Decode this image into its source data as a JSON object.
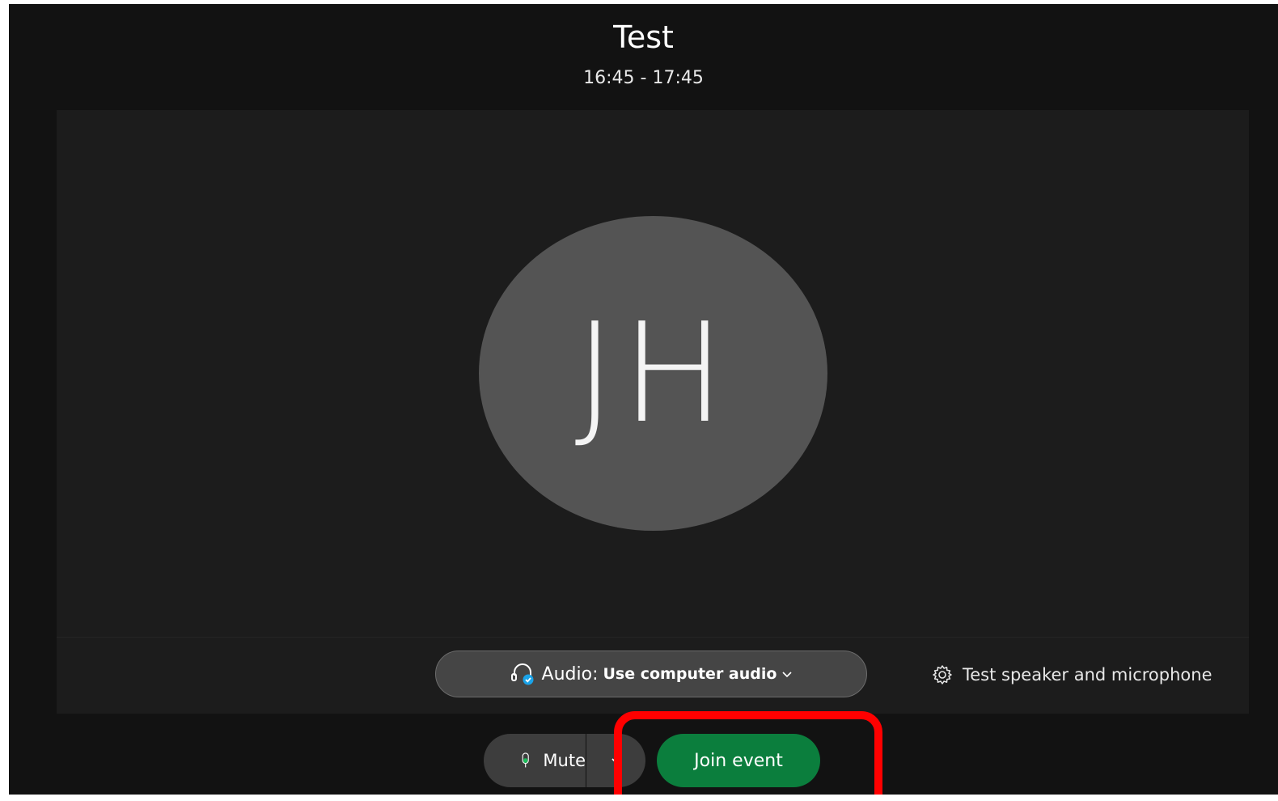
{
  "event": {
    "title": "Test",
    "time_range": "16:45 - 17:45"
  },
  "avatar": {
    "initials": "JH"
  },
  "audio": {
    "label": "Audio:",
    "value": "Use computer audio",
    "icon": "headset-connected-icon"
  },
  "test_link": {
    "label": "Test speaker and microphone",
    "icon": "gear-icon"
  },
  "controls": {
    "mute_label": "Mute",
    "join_label": "Join event"
  },
  "colors": {
    "background": "#121212",
    "preview": "#1c1c1c",
    "avatar": "#545454",
    "join_button": "#0b7e3d",
    "highlight": "#ff0000",
    "mic_level": "#1ac05a",
    "audio_badge": "#1aa3e8"
  }
}
